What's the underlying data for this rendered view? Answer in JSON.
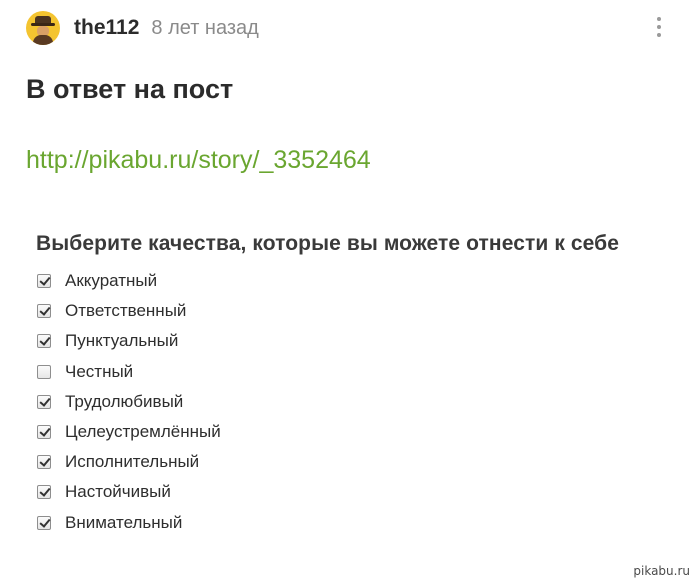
{
  "post": {
    "author": "the112",
    "time": "8 лет назад",
    "avatar_icon": "avatar-icon",
    "more_icon": "more-vertical-icon",
    "title": "В ответ на пост",
    "link": "http://pikabu.ru/story/_3352464"
  },
  "image": {
    "heading": "Выберите качества, которые вы можете отнести к себе",
    "options": [
      {
        "label": "Аккуратный",
        "checked": true
      },
      {
        "label": "Ответственный",
        "checked": true
      },
      {
        "label": "Пунктуальный",
        "checked": true
      },
      {
        "label": "Честный",
        "checked": false
      },
      {
        "label": "Трудолюбивый",
        "checked": true
      },
      {
        "label": "Целеустремлённый",
        "checked": true
      },
      {
        "label": "Исполнительный",
        "checked": true
      },
      {
        "label": "Настойчивый",
        "checked": true
      },
      {
        "label": "Внимательный",
        "checked": true
      }
    ],
    "watermark": "pikabu.ru"
  },
  "colors": {
    "link": "#6aa630",
    "avatar_bg": "#f4c430"
  }
}
